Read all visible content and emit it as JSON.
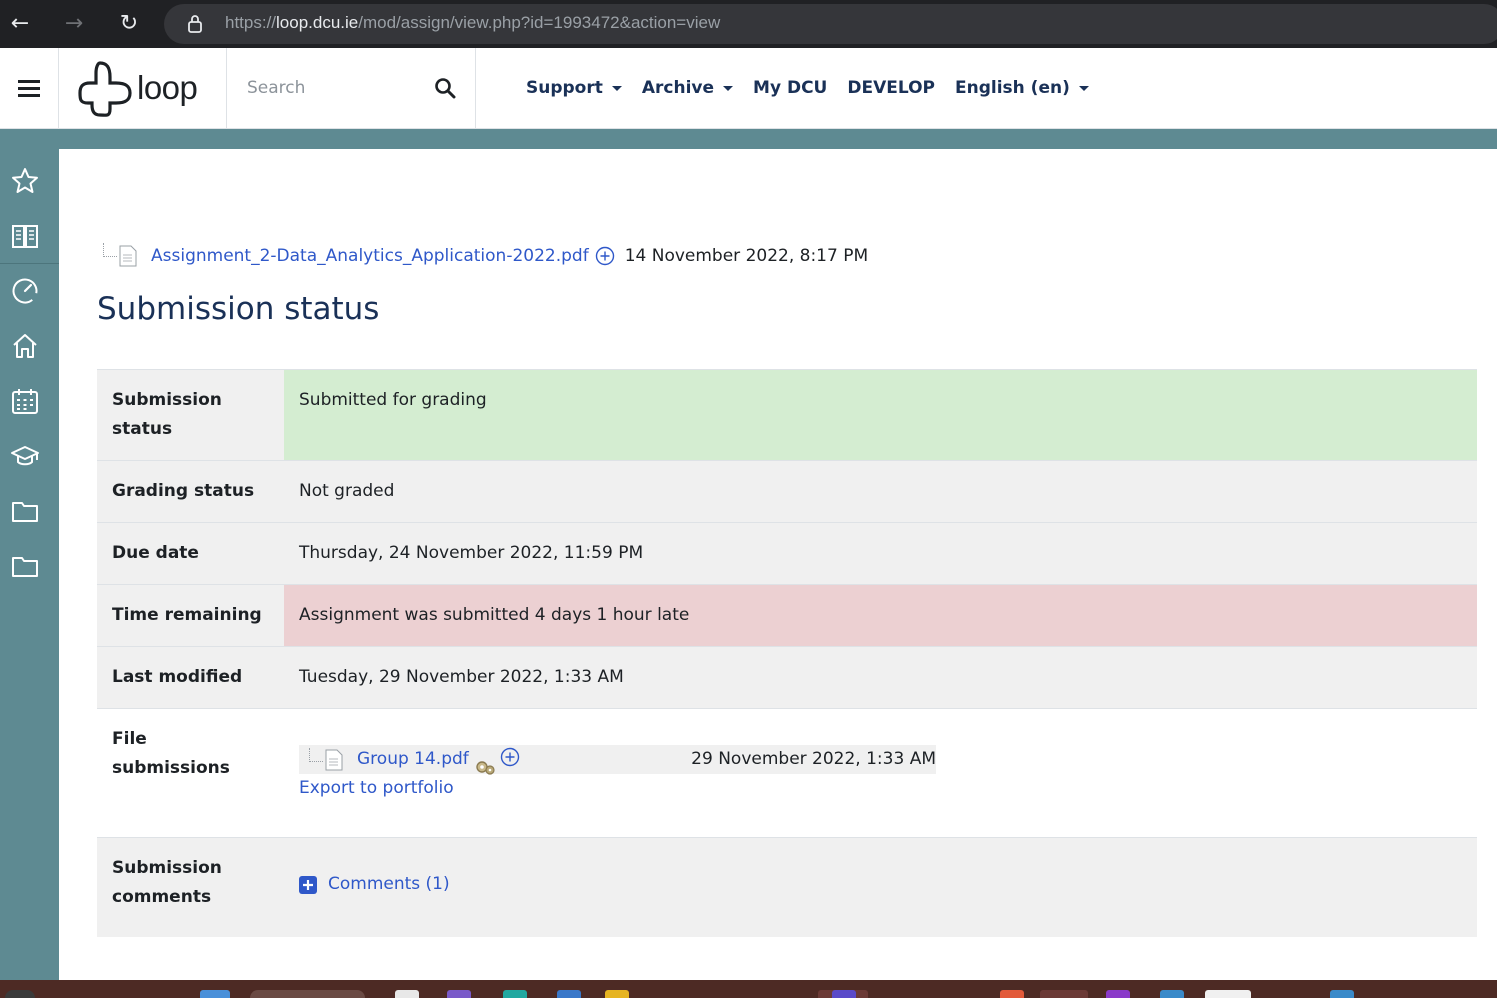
{
  "browser": {
    "url_host": "loop.dcu.ie",
    "url_scheme": "https://",
    "url_path": "/mod/assign/view.php?id=1993472&action=view"
  },
  "navbar": {
    "logo_text": "loop",
    "search_placeholder": "Search",
    "menu": [
      {
        "label": "Support",
        "has_dropdown": true
      },
      {
        "label": "Archive",
        "has_dropdown": true
      },
      {
        "label": "My DCU",
        "has_dropdown": false
      },
      {
        "label": "DEVELOP",
        "has_dropdown": false
      },
      {
        "label": "English (en)",
        "has_dropdown": true
      }
    ]
  },
  "rail": {
    "icons": [
      "star-icon",
      "book-icon",
      "dashboard-icon",
      "home-icon",
      "calendar-icon",
      "graduation-cap-icon",
      "folder-icon",
      "folder-icon"
    ]
  },
  "assignment_file": {
    "name": "Assignment_2-Data_Analytics_Application-2022.pdf",
    "date": "14 November 2022, 8:17 PM"
  },
  "section_heading": "Submission status",
  "status": {
    "submission_status_label": "Submission status",
    "submission_status_value": "Submitted for grading",
    "grading_status_label": "Grading status",
    "grading_status_value": "Not graded",
    "due_date_label": "Due date",
    "due_date_value": "Thursday, 24 November 2022, 11:59 PM",
    "time_remaining_label": "Time remaining",
    "time_remaining_value": "Assignment was submitted 4 days 1 hour late",
    "last_modified_label": "Last modified",
    "last_modified_value": "Tuesday, 29 November 2022, 1:33 AM",
    "file_submissions_label": "File submissions",
    "file_name": "Group 14.pdf",
    "file_date": "29 November 2022, 1:33 AM",
    "export_label": "Export to portfolio",
    "comments_label": "Submission comments",
    "comments_link": "Comments (1)"
  },
  "colors": {
    "navbar_text": "#1a3157",
    "link": "#2f58c9",
    "rail": "#5e8a92",
    "status_ok": "#d4edd1",
    "status_late": "#ecd0d2"
  }
}
